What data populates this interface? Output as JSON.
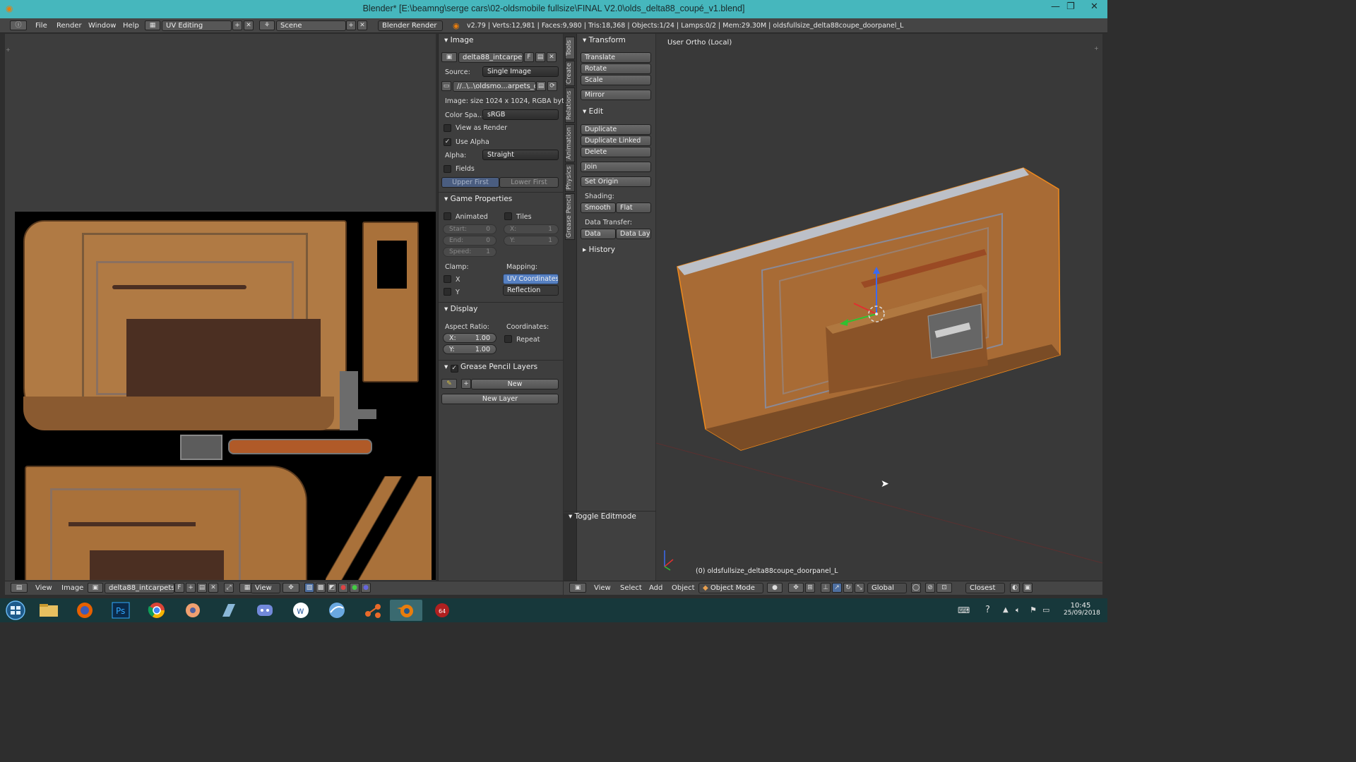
{
  "window": {
    "title": "Blender* [E:\\beamng\\serge cars\\02-oldsmobile fullsize\\FINAL V2.0\\olds_delta88_coupé_v1.blend]"
  },
  "menu": {
    "file": "File",
    "render": "Render",
    "window": "Window",
    "help": "Help"
  },
  "layout": {
    "screen": "UV Editing",
    "scene": "Scene",
    "engine": "Blender Render"
  },
  "stats": "v2.79 | Verts:12,981 | Faces:9,980 | Tris:18,368 | Objects:1/24 | Lamps:0/2 | Mem:29.30M | oldsfullsize_delta88coupe_doorpanel_L",
  "image_panel": {
    "header": "Image",
    "image_name": "delta88_intcarpet...",
    "fake_user": "F",
    "source_label": "Source:",
    "source_value": "Single Image",
    "filepath": "//..\\..\\oldsmo...arpets_d.dds",
    "image_info": "Image: size 1024 x 1024, RGBA byte",
    "colorspace_label": "Color Spa...",
    "colorspace_value": "sRGB",
    "view_as_render": "View as Render",
    "use_alpha": "Use Alpha",
    "alpha_label": "Alpha:",
    "alpha_value": "Straight",
    "fields": "Fields",
    "upper_first": "Upper First",
    "lower_first": "Lower First"
  },
  "game_panel": {
    "header": "Game Properties",
    "animated": "Animated",
    "tiles": "Tiles",
    "start": "Start:",
    "start_val": "0",
    "end": "End:",
    "end_val": "0",
    "speed": "Speed:",
    "speed_val": "1",
    "tx": "X:",
    "tx_val": "1",
    "ty": "Y:",
    "ty_val": "1",
    "clamp": "Clamp:",
    "mapping": "Mapping:",
    "cx": "X",
    "cy": "Y",
    "uv_coords": "UV Coordinates",
    "reflection": "Reflection"
  },
  "display_panel": {
    "header": "Display",
    "aspect": "Aspect Ratio:",
    "coordinates": "Coordinates:",
    "ax": "X:",
    "ax_val": "1.00",
    "ay": "Y:",
    "ay_val": "1.00",
    "repeat": "Repeat"
  },
  "gp_panel": {
    "header": "Grease Pencil Layers",
    "new": "New",
    "new_layer": "New Layer"
  },
  "vtabs": [
    "Tools",
    "Create",
    "Relations",
    "Animation",
    "Physics",
    "Grease Pencil"
  ],
  "tools": {
    "transform": "Transform",
    "translate": "Translate",
    "rotate": "Rotate",
    "scale": "Scale",
    "mirror": "Mirror",
    "edit": "Edit",
    "duplicate": "Duplicate",
    "duplicate_linked": "Duplicate Linked",
    "delete": "Delete",
    "join": "Join",
    "set_origin": "Set Origin",
    "shading": "Shading:",
    "smooth": "Smooth",
    "flat": "Flat",
    "data_transfer": "Data Transfer:",
    "data": "Data",
    "data_layo": "Data Layo",
    "history": "History",
    "toggle_editmode": "Toggle Editmode"
  },
  "viewport": {
    "view_name": "User Ortho (Local)",
    "object_label": "(0) oldsfullsize_delta88coupe_doorpanel_L"
  },
  "uv_header": {
    "view": "View",
    "image": "Image",
    "image_name": "delta88_intcarpets_...",
    "f": "F",
    "view2": "View"
  },
  "v3d_header": {
    "view": "View",
    "select": "Select",
    "add": "Add",
    "object": "Object",
    "mode": "Object Mode",
    "orientation": "Global",
    "snap": "Closest"
  },
  "clock": {
    "time": "10:45",
    "date": "25/09/2018"
  },
  "colors": {
    "titlebar": "#46b7bd",
    "active_blue": "#5680c2",
    "selection_orange": "#f08a1c",
    "taskbar": "#17383b"
  }
}
